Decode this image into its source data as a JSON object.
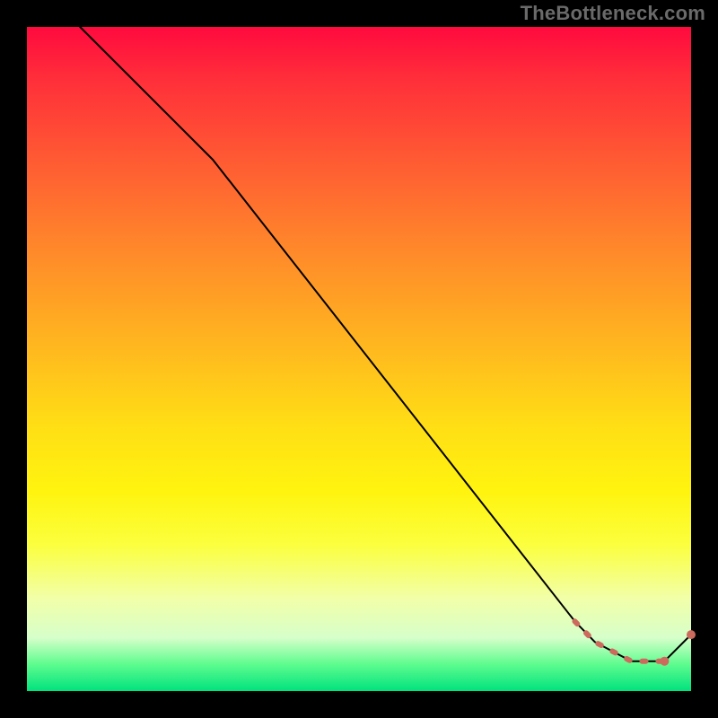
{
  "watermark": "TheBottleneck.com",
  "colors": {
    "background": "#000000",
    "line": "#000000",
    "dashed": "#cc6a5d",
    "watermark": "#6a6a6a"
  },
  "chart_data": {
    "type": "line",
    "title": "",
    "xlabel": "",
    "ylabel": "",
    "xlim": [
      0,
      100
    ],
    "ylim": [
      0,
      100
    ],
    "grid": false,
    "series": [
      {
        "name": "solid-curve",
        "style": "solid",
        "color": "#000000",
        "x": [
          8,
          28,
          82.5,
          85.5,
          91,
          96,
          100
        ],
        "y": [
          100,
          80,
          10.5,
          7.4,
          4.5,
          4.5,
          8.5
        ]
      },
      {
        "name": "dashed-bottom",
        "style": "dashed",
        "color": "#cc6a5d",
        "x": [
          82.5,
          85.5,
          91,
          96
        ],
        "y": [
          10.5,
          7.4,
          4.5,
          4.5
        ]
      }
    ],
    "points": [
      {
        "x": 96,
        "y": 4.5,
        "color": "#cc6a5d"
      },
      {
        "x": 100,
        "y": 8.5,
        "color": "#cc6a5d"
      }
    ]
  }
}
